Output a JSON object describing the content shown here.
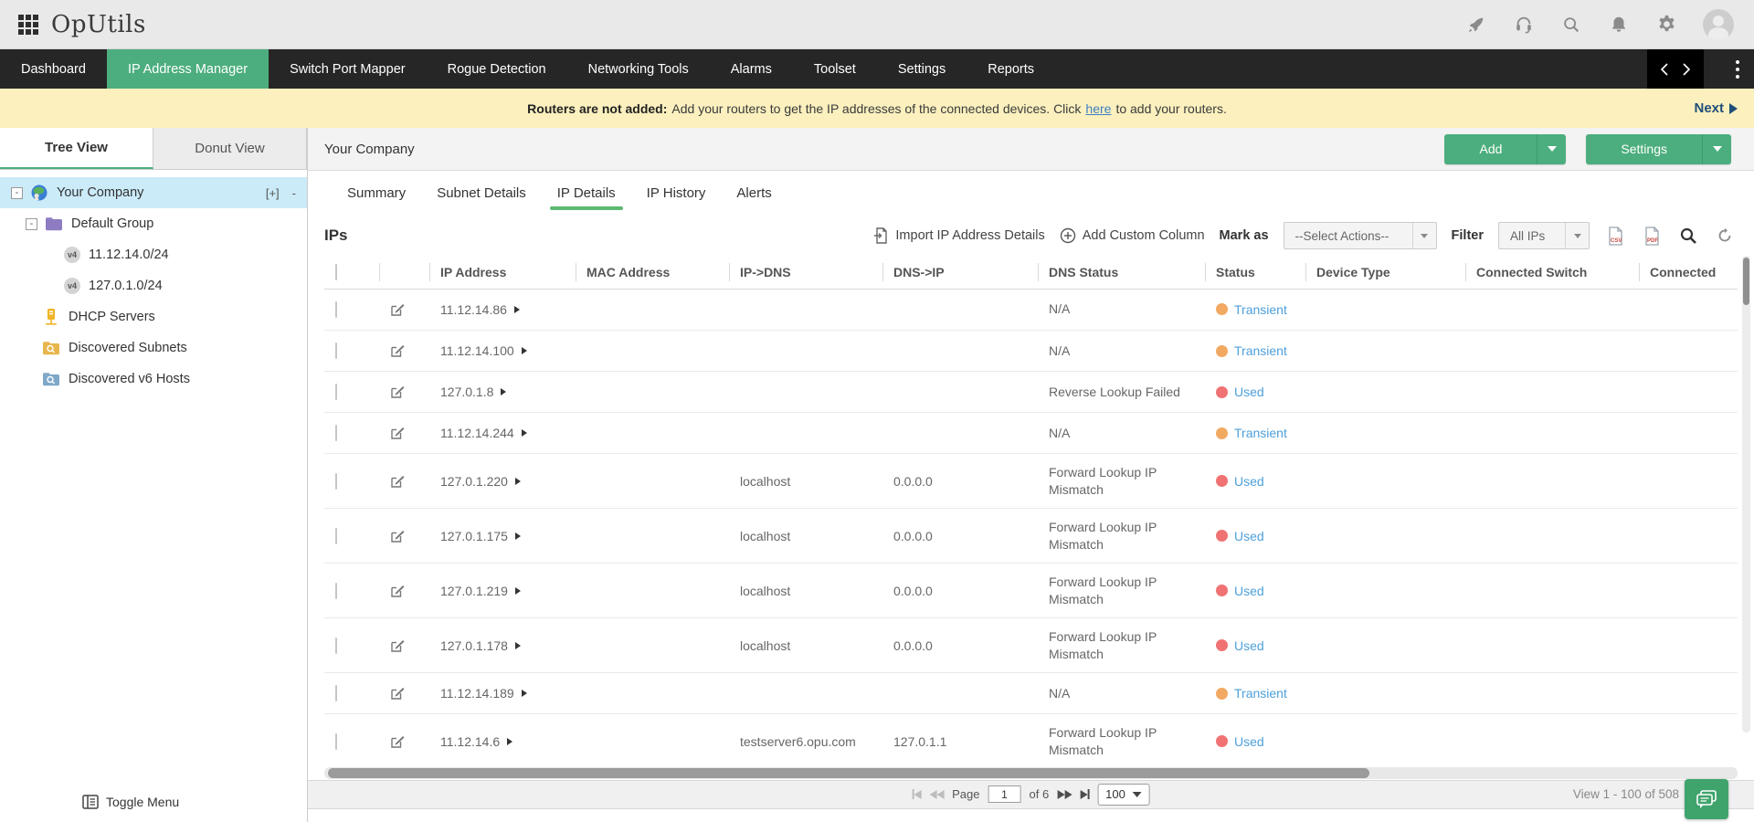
{
  "app": {
    "name": "OpUtils"
  },
  "header": {
    "icons": [
      "apps-grid",
      "rocket",
      "headset",
      "search",
      "bell",
      "gear",
      "avatar"
    ]
  },
  "nav": {
    "items": [
      {
        "label": "Dashboard",
        "active": false
      },
      {
        "label": "IP Address Manager",
        "active": true
      },
      {
        "label": "Switch Port Mapper",
        "active": false
      },
      {
        "label": "Rogue Detection",
        "active": false
      },
      {
        "label": "Networking Tools",
        "active": false
      },
      {
        "label": "Alarms",
        "active": false
      },
      {
        "label": "Toolset",
        "active": false
      },
      {
        "label": "Settings",
        "active": false
      },
      {
        "label": "Reports",
        "active": false
      }
    ]
  },
  "banner": {
    "bold": "Routers are not added:",
    "text": "Add your routers to get the IP addresses of the connected devices. Click",
    "link": "here",
    "after": "to add your routers.",
    "next": "Next"
  },
  "sidebar": {
    "tabs": [
      {
        "label": "Tree View",
        "active": true
      },
      {
        "label": "Donut View",
        "active": false
      }
    ],
    "tree": {
      "company": {
        "label": "Your Company",
        "add": "[+]",
        "remove": "-"
      },
      "group": {
        "label": "Default Group"
      },
      "subnet1": {
        "label": "11.12.14.0/24",
        "badge": "v4"
      },
      "subnet2": {
        "label": "127.0.1.0/24",
        "badge": "v4"
      },
      "dhcp": {
        "label": "DHCP Servers"
      },
      "discovered_subnets": {
        "label": "Discovered Subnets"
      },
      "discovered_v6": {
        "label": "Discovered v6 Hosts"
      }
    },
    "toggle_menu": "Toggle Menu"
  },
  "content": {
    "breadcrumb": "Your Company",
    "actions": {
      "add": "Add",
      "settings": "Settings"
    },
    "tabs": [
      {
        "label": "Summary",
        "active": false
      },
      {
        "label": "Subnet Details",
        "active": false
      },
      {
        "label": "IP Details",
        "active": true
      },
      {
        "label": "IP History",
        "active": false
      },
      {
        "label": "Alerts",
        "active": false
      }
    ],
    "toolbar": {
      "heading": "IPs",
      "import_label": "Import IP Address Details",
      "add_custom_label": "Add Custom Column",
      "mark_as": "Mark as",
      "select_actions": "--Select Actions--",
      "filter": "Filter",
      "filter_value": "All IPs"
    },
    "table": {
      "columns": [
        "IP Address",
        "MAC Address",
        "IP->DNS",
        "DNS->IP",
        "DNS Status",
        "Status",
        "Device Type",
        "Connected Switch",
        "Connected"
      ],
      "rows": [
        {
          "ip": "11.12.14.86",
          "mac": "",
          "ip_dns": "",
          "dns_ip": "",
          "dns_status": "N/A",
          "status": "Transient",
          "status_type": "transient",
          "tall": false,
          "device_type": "",
          "connected_switch": "",
          "connected": ""
        },
        {
          "ip": "11.12.14.100",
          "mac": "",
          "ip_dns": "",
          "dns_ip": "",
          "dns_status": "N/A",
          "status": "Transient",
          "status_type": "transient",
          "tall": false,
          "device_type": "",
          "connected_switch": "",
          "connected": ""
        },
        {
          "ip": "127.0.1.8",
          "mac": "",
          "ip_dns": "",
          "dns_ip": "",
          "dns_status": "Reverse Lookup Failed",
          "status": "Used",
          "status_type": "used",
          "tall": false,
          "device_type": "",
          "connected_switch": "",
          "connected": ""
        },
        {
          "ip": "11.12.14.244",
          "mac": "",
          "ip_dns": "",
          "dns_ip": "",
          "dns_status": "N/A",
          "status": "Transient",
          "status_type": "transient",
          "tall": false,
          "device_type": "",
          "connected_switch": "",
          "connected": ""
        },
        {
          "ip": "127.0.1.220",
          "mac": "",
          "ip_dns": "localhost",
          "dns_ip": "0.0.0.0",
          "dns_status": "Forward Lookup IP Mismatch",
          "status": "Used",
          "status_type": "used",
          "tall": true,
          "device_type": "",
          "connected_switch": "",
          "connected": ""
        },
        {
          "ip": "127.0.1.175",
          "mac": "",
          "ip_dns": "localhost",
          "dns_ip": "0.0.0.0",
          "dns_status": "Forward Lookup IP Mismatch",
          "status": "Used",
          "status_type": "used",
          "tall": true,
          "device_type": "",
          "connected_switch": "",
          "connected": ""
        },
        {
          "ip": "127.0.1.219",
          "mac": "",
          "ip_dns": "localhost",
          "dns_ip": "0.0.0.0",
          "dns_status": "Forward Lookup IP Mismatch",
          "status": "Used",
          "status_type": "used",
          "tall": true,
          "device_type": "",
          "connected_switch": "",
          "connected": ""
        },
        {
          "ip": "127.0.1.178",
          "mac": "",
          "ip_dns": "localhost",
          "dns_ip": "0.0.0.0",
          "dns_status": "Forward Lookup IP Mismatch",
          "status": "Used",
          "status_type": "used",
          "tall": true,
          "device_type": "",
          "connected_switch": "",
          "connected": ""
        },
        {
          "ip": "11.12.14.189",
          "mac": "",
          "ip_dns": "",
          "dns_ip": "",
          "dns_status": "N/A",
          "status": "Transient",
          "status_type": "transient",
          "tall": false,
          "device_type": "",
          "connected_switch": "",
          "connected": ""
        },
        {
          "ip": "11.12.14.6",
          "mac": "",
          "ip_dns": "testserver6.opu.com",
          "dns_ip": "127.0.1.1",
          "dns_status": "Forward Lookup IP Mismatch",
          "status": "Used",
          "status_type": "used",
          "tall": true,
          "device_type": "",
          "connected_switch": "",
          "connected": ""
        }
      ]
    },
    "pagination": {
      "page_label": "Page",
      "page_value": "1",
      "of_label": "of 6",
      "page_size": "100",
      "view_label": "View 1 - 100 of 508"
    }
  },
  "colors": {
    "accent_green": "#4cae7e",
    "status_transient": "#f2a962",
    "status_used": "#f07272",
    "link_blue": "#4d9fdb",
    "banner_bg": "#fbf0be",
    "nav_bg": "#262626"
  }
}
